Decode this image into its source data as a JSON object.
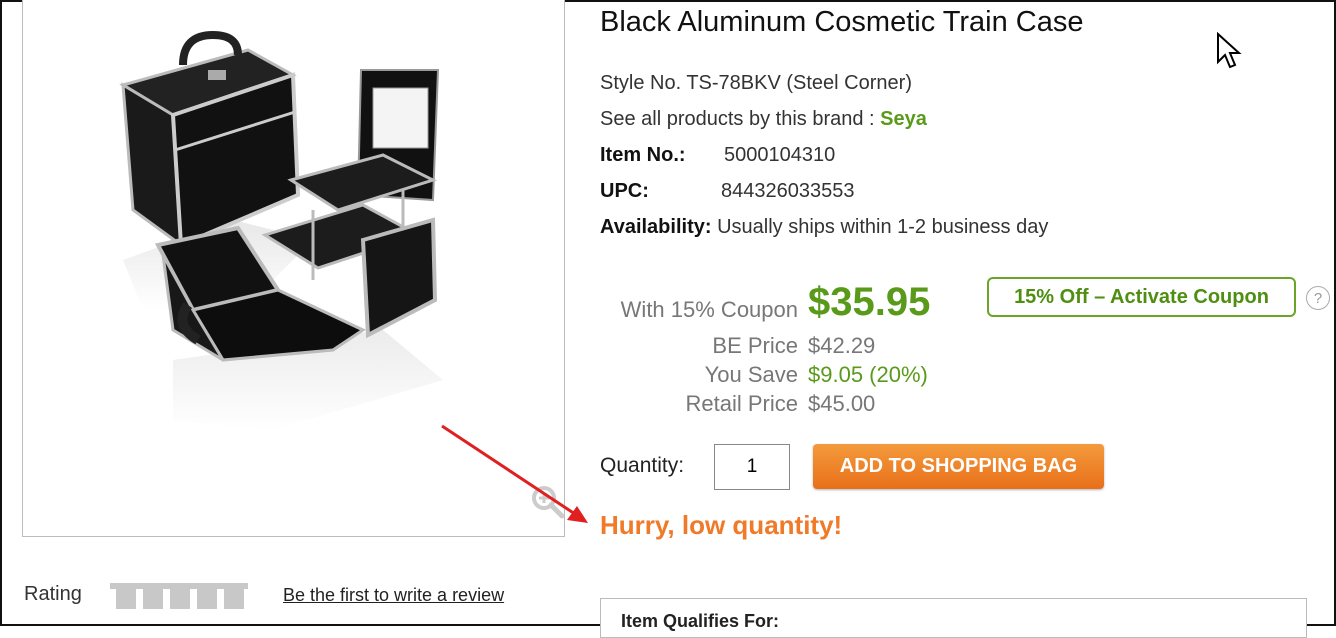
{
  "product": {
    "title": "Black Aluminum Cosmetic Train Case",
    "style_text": "Style No. TS-78BKV (Steel Corner)",
    "brand_prefix": "See all products by this brand : ",
    "brand_name": "Seya",
    "item_no_label": "Item No.:",
    "item_no": "5000104310",
    "upc_label": "UPC:",
    "upc": "844326033553",
    "availability_label": "Availability:",
    "availability": "Usually ships within 1-2 business day"
  },
  "pricing": {
    "coupon_label": "With 15% Coupon",
    "coupon_price": "$35.95",
    "be_label": "BE Price",
    "be_price": "$42.29",
    "save_label": "You Save",
    "save_value": "$9.05 (20%)",
    "retail_label": "Retail Price",
    "retail_price": "$45.00",
    "coupon_button": "15% Off – Activate Coupon",
    "help_icon": "?"
  },
  "purchase": {
    "quantity_label": "Quantity:",
    "quantity_value": "1",
    "add_button": "ADD TO SHOPPING BAG",
    "stock_notice": "Hurry, low quantity!"
  },
  "reviews": {
    "rating_label": "Rating",
    "write_review": "Be the first to write a review",
    "stars_filled": 0,
    "stars_total": 5
  },
  "qualifies": {
    "title": "Item Qualifies For:"
  },
  "colors": {
    "brand_green": "#5a9a1a",
    "button_orange": "#e8701a",
    "notice_orange": "#f07a28",
    "annotation_red": "#e02020"
  },
  "icons": [
    "zoom-in-icon",
    "help-icon",
    "mouse-cursor-icon",
    "rating-stars-icon"
  ]
}
